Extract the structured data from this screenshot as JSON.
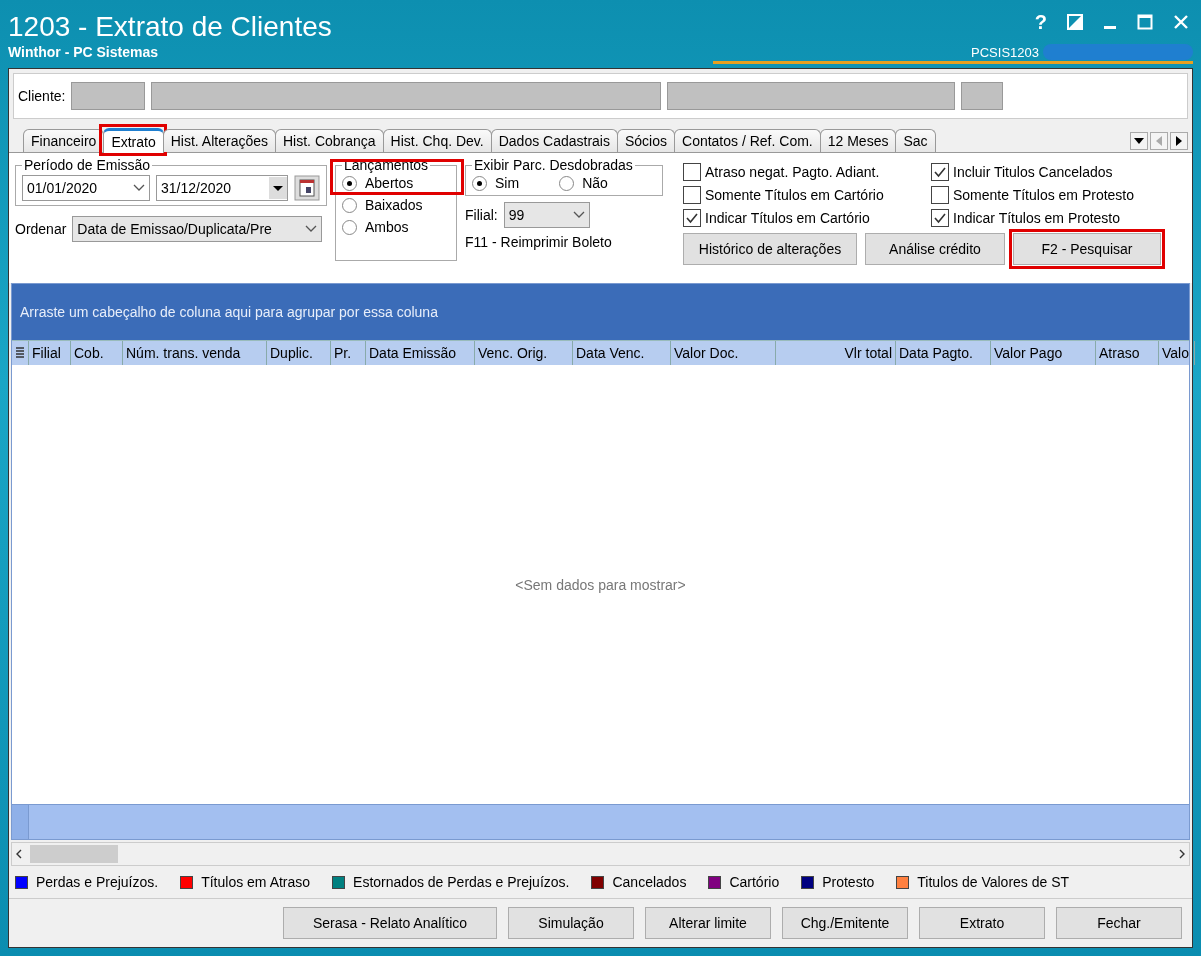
{
  "window": {
    "title": "1203 - Extrato de Clientes",
    "subtitle": "Winthor - PC Sistemas",
    "routine_code": "PCSIS1203",
    "help_label": "?"
  },
  "client": {
    "label": "Cliente:"
  },
  "tabs": [
    {
      "label": "Financeiro",
      "selected": false,
      "highlighted": false
    },
    {
      "label": "Extrato",
      "selected": true,
      "highlighted": true
    },
    {
      "label": "Hist. Alterações",
      "selected": false,
      "highlighted": false
    },
    {
      "label": "Hist. Cobrança",
      "selected": false,
      "highlighted": false
    },
    {
      "label": "Hist. Chq. Dev.",
      "selected": false,
      "highlighted": false
    },
    {
      "label": "Dados Cadastrais",
      "selected": false,
      "highlighted": false
    },
    {
      "label": "Sócios",
      "selected": false,
      "highlighted": false
    },
    {
      "label": "Contatos / Ref. Com.",
      "selected": false,
      "highlighted": false
    },
    {
      "label": "12 Meses",
      "selected": false,
      "highlighted": false
    },
    {
      "label": "Sac",
      "selected": false,
      "highlighted": false
    }
  ],
  "periodo": {
    "legend": "Período de Emissão",
    "start": "01/01/2020",
    "end": "31/12/2020"
  },
  "ordenar": {
    "label": "Ordenar",
    "value": "Data de Emissao/Duplicata/Pre"
  },
  "lancamentos": {
    "legend": "Lançamentos",
    "highlighted": true,
    "options": [
      {
        "label": "Abertos",
        "selected": true
      },
      {
        "label": "Baixados",
        "selected": false
      },
      {
        "label": "Ambos",
        "selected": false
      }
    ]
  },
  "parcelas": {
    "legend": "Exibir Parc. Desdobradas",
    "options": [
      {
        "label": "Sim",
        "selected": true
      },
      {
        "label": "Não",
        "selected": false
      }
    ]
  },
  "filial": {
    "label": "Filial:",
    "value": "99"
  },
  "reprint_hint": "F11 - Reimprimir Boleto",
  "checkboxes": [
    {
      "label": "Atraso negat. Pagto. Adiant.",
      "checked": false
    },
    {
      "label": "Incluir Titulos Cancelados",
      "checked": true
    },
    {
      "label": "Somente Títulos em Cartório",
      "checked": false
    },
    {
      "label": "Somente Títulos em Protesto",
      "checked": false
    },
    {
      "label": "Indicar Títulos em Cartório",
      "checked": true
    },
    {
      "label": "Indicar Títulos em Protesto",
      "checked": true
    }
  ],
  "action_buttons": [
    {
      "label": "Histórico de alterações",
      "highlighted": false
    },
    {
      "label": "Análise crédito",
      "highlighted": false
    },
    {
      "label": "F2 - Pesquisar",
      "highlighted": true
    }
  ],
  "grid": {
    "group_hint": "Arraste um cabeçalho de coluna aqui para agrupar por essa coluna",
    "empty_text": "<Sem dados para mostrar>",
    "columns": [
      "Filial",
      "Cob.",
      "Núm. trans. venda",
      "Duplic.",
      "Pr.",
      "Data Emissão",
      "Venc. Orig.",
      "Data Venc.",
      "Valor Doc.",
      "Vlr total",
      "Data Pagto.",
      "Valor Pago",
      "Atraso",
      "Valo"
    ]
  },
  "legend": [
    {
      "label": "Perdas e Prejuízos.",
      "color": "#0000ff"
    },
    {
      "label": "Títulos em Atraso",
      "color": "#ff0000"
    },
    {
      "label": "Estornados de Perdas e Prejuízos.",
      "color": "#008080"
    },
    {
      "label": "Cancelados",
      "color": "#800000"
    },
    {
      "label": "Cartório",
      "color": "#800080"
    },
    {
      "label": "Protesto",
      "color": "#000080"
    },
    {
      "label": "Titulos de Valores de ST",
      "color": "#ff8040"
    }
  ],
  "footer_buttons": [
    "Serasa - Relato Analítico",
    "Simulação",
    "Alterar limite",
    "Chg./Emitente",
    "Extrato",
    "Fechar"
  ]
}
